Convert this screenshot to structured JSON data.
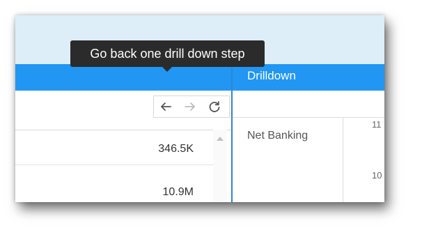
{
  "tooltip": {
    "text": "Go back one drill down step"
  },
  "drilldown_panel": {
    "title": "Drilldown",
    "category_label": "Net Banking",
    "axis_ticks": [
      "11",
      "10"
    ]
  },
  "left_table": {
    "rows": [
      {
        "value": "346.5K"
      },
      {
        "value": "10.9M"
      }
    ]
  },
  "nav": {
    "back_icon": "arrow-left-icon",
    "forward_icon": "arrow-right-icon",
    "refresh_icon": "refresh-icon"
  },
  "colors": {
    "header_blue": "#2196f3",
    "top_bar": "#ddeef8",
    "tooltip_bg": "#2b2b2b"
  }
}
